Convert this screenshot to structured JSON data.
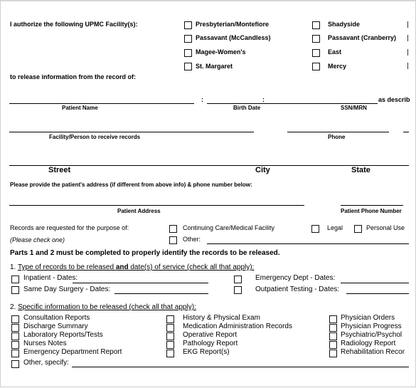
{
  "authorize": {
    "label": "I authorize the following UPMC Facility(s):",
    "facilities_left": [
      "Presbyterian/Montefiore",
      "Passavant (McCandless)",
      "Magee-Women's",
      "St. Margaret"
    ],
    "facilities_right": [
      "Shadyside",
      "Passavant (Cranberry)",
      "East",
      "Mercy"
    ],
    "release_from": "to release information from the record of:"
  },
  "patient_fields": {
    "sep": ":",
    "patient_name": "Patient Name",
    "birth_date": "Birth Date",
    "ssn_mrn": "SSN/MRN",
    "as_described": "as describ",
    "facility_person": "Facility/Person to receive records",
    "phone": "Phone"
  },
  "address_headers": {
    "street": "Street",
    "city": "City",
    "state": "State"
  },
  "patient_address": {
    "prompt": "Please provide the patient's address (if different from above info) & phone number below:",
    "address_label": "Patient Address",
    "phone_label": "Patient Phone Number"
  },
  "purpose": {
    "label": "Records are requested for the purpose of:",
    "hint": "(Please check one)",
    "options": [
      "Continuing Care/Medical Facility",
      "Legal",
      "Personal Use",
      "Other:"
    ]
  },
  "notice": "Parts 1 and 2 must be completed to properly identify the records to be released.",
  "part1": {
    "number": "1.",
    "title_a": "Type of records to be released ",
    "title_and": "and",
    "title_b": " date(s) of service (check all that apply):",
    "items": [
      "Inpatient - Dates:",
      "Same Day Surgery - Dates:",
      "Emergency Dept - Dates:",
      "Outpatient Testing - Dates:"
    ]
  },
  "part2": {
    "number": "2.",
    "title": "Specific information to be released (check all that apply):",
    "col1": [
      "Consultation Reports",
      "Discharge Summary",
      "Laboratory Reports/Tests",
      "Nurses Notes",
      "Emergency Department Report"
    ],
    "col2": [
      "History & Physical Exam",
      "Medication Administration Records",
      "Operative Report",
      "Pathology Report",
      "EKG Report(s)"
    ],
    "col3": [
      "Physician Orders",
      "Physician Progress",
      "Psychiatric/Psychol",
      "Radiology Report",
      "Rehabilitation Recor"
    ],
    "other": "Other, specify:"
  }
}
